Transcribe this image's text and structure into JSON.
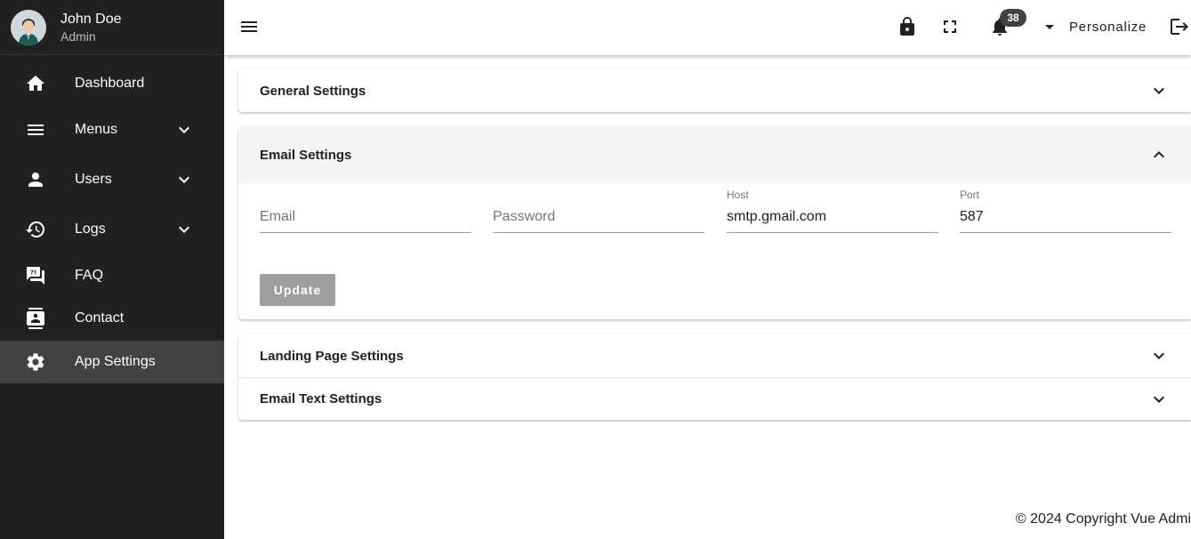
{
  "user": {
    "name": "John Doe",
    "role": "Admin"
  },
  "sidebar": {
    "items": [
      {
        "label": "Dashboard",
        "icon": "home-icon",
        "has_submenu": false
      },
      {
        "label": "Menus",
        "icon": "menu-icon",
        "has_submenu": true
      },
      {
        "label": "Users",
        "icon": "person-icon",
        "has_submenu": true
      },
      {
        "label": "Logs",
        "icon": "history-icon",
        "has_submenu": true
      },
      {
        "label": "FAQ",
        "icon": "faq-icon",
        "has_submenu": false
      },
      {
        "label": "Contact",
        "icon": "contact-icon",
        "has_submenu": false
      },
      {
        "label": "App Settings",
        "icon": "gear-icon",
        "has_submenu": false,
        "active": true
      }
    ]
  },
  "topbar": {
    "notification_count": "38",
    "personalize_label": "Personalize"
  },
  "settings": {
    "general": {
      "title": "General Settings"
    },
    "email": {
      "title": "Email Settings",
      "fields": {
        "email": {
          "placeholder": "Email",
          "value": ""
        },
        "password": {
          "placeholder": "Password",
          "value": ""
        },
        "host": {
          "label": "Host",
          "value": "smtp.gmail.com"
        },
        "port": {
          "label": "Port",
          "value": "587"
        }
      },
      "update_label": "Update"
    },
    "landing": {
      "title": "Landing Page Settings"
    },
    "email_text": {
      "title": "Email Text Settings"
    }
  },
  "footer": {
    "text": "© 2024 Copyright Vue Admi"
  },
  "colors": {
    "sidebar_bg": "#212121",
    "sidebar_active": "#424242",
    "disabled_button": "#9e9e9e"
  }
}
